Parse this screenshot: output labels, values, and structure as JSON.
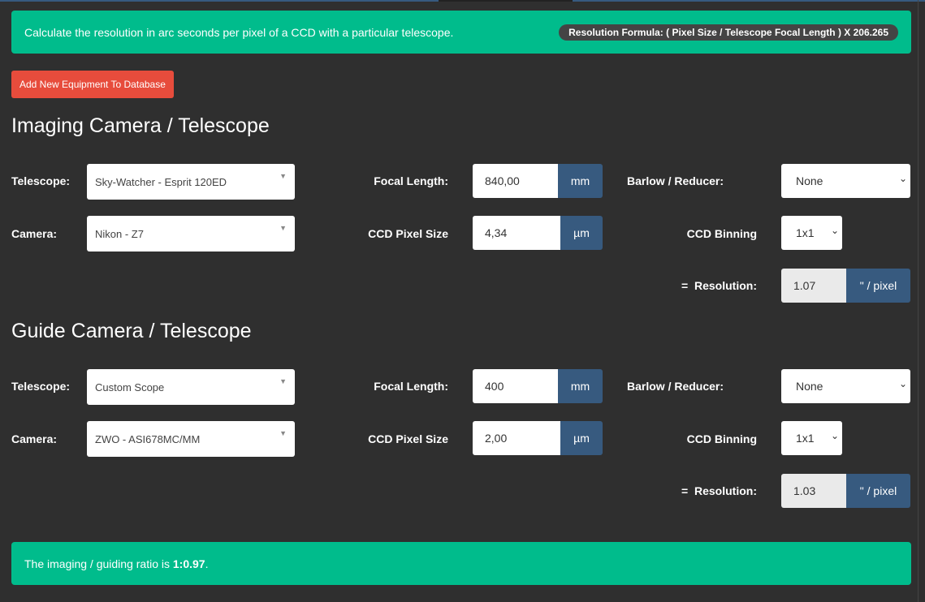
{
  "header": {
    "description": "Calculate the resolution in arc seconds per pixel of a CCD with a particular telescope.",
    "formula": "Resolution Formula:  (  Pixel Size  /  Telescope Focal Length  )  X 206.265"
  },
  "add_button": "Add New Equipment To Database",
  "imaging": {
    "title": "Imaging Camera / Telescope",
    "telescope_label": "Telescope:",
    "telescope": "Sky-Watcher - Esprit 120ED",
    "camera_label": "Camera:",
    "camera": "Nikon - Z7",
    "focal_label": "Focal Length:",
    "focal": "840,00",
    "focal_unit": "mm",
    "pixel_label": "CCD Pixel Size",
    "pixel": "4,34",
    "pixel_unit": "µm",
    "barlow_label": "Barlow / Reducer:",
    "barlow": "None",
    "binning_label": "CCD Binning",
    "binning": "1x1",
    "res_label": "=  Resolution:",
    "res": "1.07",
    "res_unit": "\" / pixel"
  },
  "guide": {
    "title": "Guide Camera / Telescope",
    "telescope_label": "Telescope:",
    "telescope": "Custom Scope",
    "camera_label": "Camera:",
    "camera": "ZWO - ASI678MC/MM",
    "focal_label": "Focal Length:",
    "focal": "400",
    "focal_unit": "mm",
    "pixel_label": "CCD Pixel Size",
    "pixel": "2,00",
    "pixel_unit": "µm",
    "barlow_label": "Barlow / Reducer:",
    "barlow": "None",
    "binning_label": "CCD Binning",
    "binning": "1x1",
    "res_label": "=  Resolution:",
    "res": "1.03",
    "res_unit": "\" / pixel"
  },
  "footer": {
    "prefix": "The imaging / guiding ratio is ",
    "ratio": "1:0.97",
    "suffix": "."
  }
}
